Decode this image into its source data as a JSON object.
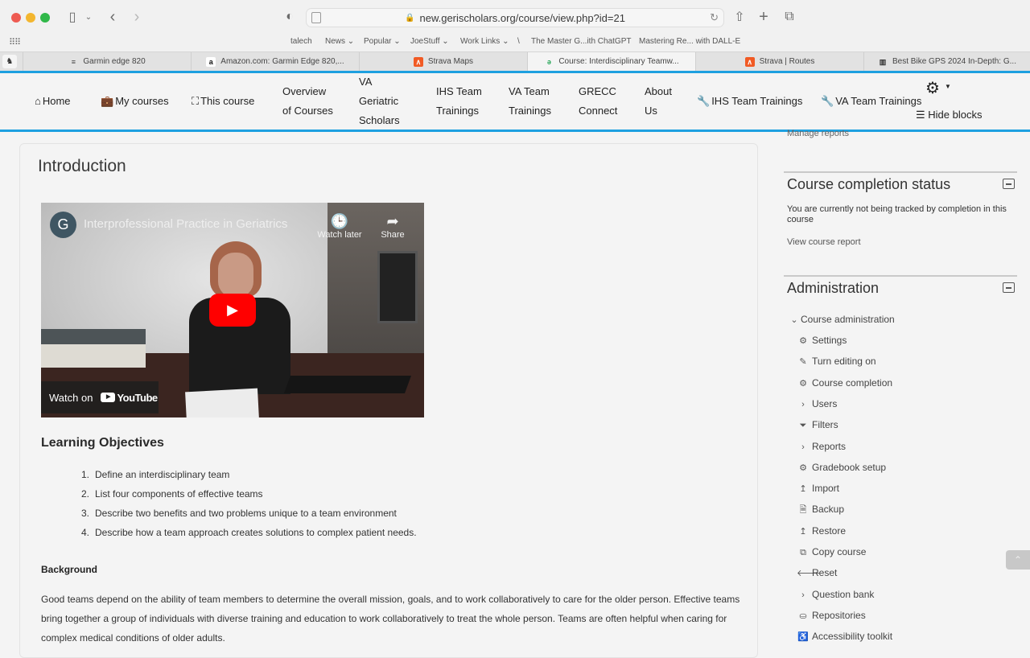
{
  "browser": {
    "url": "new.gerischolars.org/course/view.php?id=21",
    "bookmarks": [
      "talech",
      "News",
      "Popular",
      "JoeStuff",
      "Work Links",
      "\\",
      "The Master G...ith ChatGPT",
      "Mastering Re... with DALL-E"
    ],
    "bookmark_dropdowns": [
      false,
      true,
      true,
      true,
      true,
      false,
      false,
      false
    ],
    "tabs": [
      {
        "title": "Garmin edge 820",
        "active": false
      },
      {
        "title": "Amazon.com: Garmin Edge 820,...",
        "active": false
      },
      {
        "title": "Strava Maps",
        "active": false
      },
      {
        "title": "Course: Interdisciplinary Teamw...",
        "active": true
      },
      {
        "title": "Strava | Routes",
        "active": false
      },
      {
        "title": "Best Bike GPS 2024 In-Depth: G...",
        "active": false
      }
    ]
  },
  "nav": {
    "home": "Home",
    "my_courses": "My courses",
    "this_course": "This course",
    "overview": [
      "Overview",
      "of Courses"
    ],
    "va_geriatric": [
      "VA",
      "Geriatric",
      "Scholars"
    ],
    "ihs_team": [
      "IHS Team",
      "Trainings"
    ],
    "va_team": [
      "VA Team",
      "Trainings"
    ],
    "grecc": [
      "GRECC",
      "Connect"
    ],
    "about": [
      "About",
      "Us"
    ],
    "ihs_trainings_icon": "IHS Team Trainings",
    "va_trainings_icon": "VA Team Trainings",
    "hide_blocks": "Hide blocks"
  },
  "main": {
    "section_title": "Introduction",
    "video": {
      "channel_initial": "G",
      "title": "Interprofessional Practice in Geriatrics",
      "watch_later": "Watch later",
      "share": "Share",
      "watch_on": "Watch on",
      "youtube": "YouTube"
    },
    "objectives_title": "Learning Objectives",
    "objectives": [
      "Define an interdisciplinary team",
      "List four components of effective teams",
      "Describe two benefits and two problems unique to a team environment",
      "Describe how a team approach creates solutions to complex patient needs."
    ],
    "background_title": "Background",
    "background_text": "Good teams depend on the ability of team members to determine the overall mission, goals, and to work collaboratively to care for the older person.  Effective teams bring together a group of individuals with diverse training and education to work collaboratively to treat the whole person. Teams are often helpful when caring for complex medical conditions of older adults."
  },
  "blocks": {
    "manage_reports": "Manage reports",
    "completion": {
      "title": "Course completion status",
      "text": "You are currently not being tracked by completion in this course",
      "link": "View course report"
    },
    "admin": {
      "title": "Administration",
      "section": "Course administration",
      "items": [
        {
          "label": "Settings",
          "icon": "gear-icon"
        },
        {
          "label": "Turn editing on",
          "icon": "pencil-icon"
        },
        {
          "label": "Course completion",
          "icon": "gear-icon"
        },
        {
          "label": "Users",
          "icon": "chevron-right-icon"
        },
        {
          "label": "Filters",
          "icon": "filter-icon"
        },
        {
          "label": "Reports",
          "icon": "chevron-right-icon"
        },
        {
          "label": "Gradebook setup",
          "icon": "gear-icon"
        },
        {
          "label": "Import",
          "icon": "upload-arrow-icon"
        },
        {
          "label": "Backup",
          "icon": "backup-file-icon"
        },
        {
          "label": "Restore",
          "icon": "upload-arrow-icon"
        },
        {
          "label": "Copy course",
          "icon": "copy-icon"
        },
        {
          "label": "Reset",
          "icon": "arrow-left-icon"
        },
        {
          "label": "Question bank",
          "icon": "chevron-right-icon"
        },
        {
          "label": "Repositories",
          "icon": "drive-icon"
        },
        {
          "label": "Accessibility toolkit",
          "icon": "accessibility-icon"
        }
      ]
    }
  }
}
